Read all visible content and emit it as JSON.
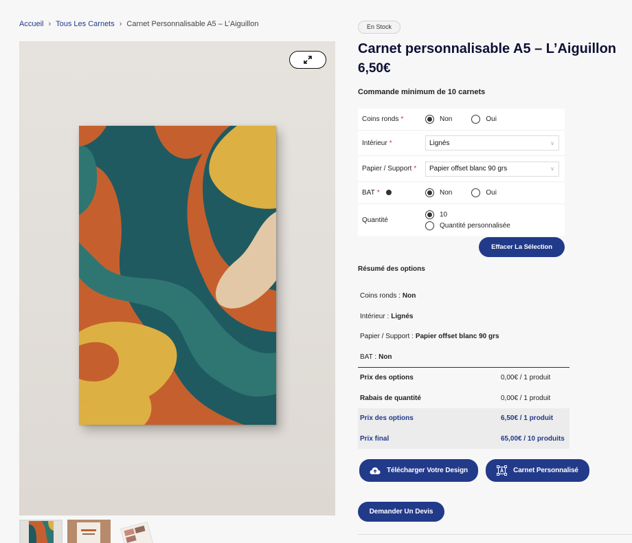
{
  "breadcrumb": {
    "home": "Accueil",
    "category": "Tous Les Carnets",
    "current": "Carnet Personnalisable A5 – L’Aiguillon"
  },
  "product": {
    "stock_badge": "En Stock",
    "title": "Carnet personnalisable A5 – L’Aiguillon",
    "price": "6,50€",
    "min_order": "Commande minimum de 10 carnets"
  },
  "options": {
    "coins_ronds": {
      "label": "Coins ronds",
      "choices": [
        "Non",
        "Oui"
      ],
      "selected": "Non"
    },
    "interieur": {
      "label": "Intérieur",
      "value": "Lignés"
    },
    "papier": {
      "label": "Papier / Support",
      "value": "Papier offset blanc 90 grs"
    },
    "bat": {
      "label": "BAT",
      "choices": [
        "Non",
        "Oui"
      ],
      "selected": "Non"
    },
    "quantite": {
      "label": "Quantité",
      "choices": [
        "10",
        "Quantité personnalisée"
      ],
      "selected": "10"
    },
    "required_mark": "*",
    "clear_button": "Effacer La Sélection"
  },
  "summary": {
    "title": "Résumé des options",
    "lines": [
      {
        "label": "Coins ronds :",
        "value": "Non"
      },
      {
        "label": "Intérieur :",
        "value": "Lignés"
      },
      {
        "label": "Papier / Support :",
        "value": "Papier offset blanc 90 grs"
      },
      {
        "label": "BAT :",
        "value": "Non"
      }
    ],
    "prices": [
      {
        "label": "Prix des options",
        "value": "0,00€ / 1 produit"
      },
      {
        "label": "Rabais de quantité",
        "value": "0,00€ / 1 produit"
      },
      {
        "label": "Prix des options",
        "value": "6,50€ / 1 produit"
      },
      {
        "label": "Prix final",
        "value": "65,00€ / 10 produits"
      }
    ]
  },
  "actions": {
    "upload": "Télécharger Votre Design",
    "custom": "Carnet Personnalisé",
    "quote": "Demander Un Devis"
  },
  "colors": {
    "accent": "#223a8a",
    "title": "#0e1035",
    "orange": "#c5602e",
    "teal": "#1f5a60",
    "teal_light": "#2f7672",
    "mustard": "#ddb043",
    "beige": "#e2c8a6"
  }
}
